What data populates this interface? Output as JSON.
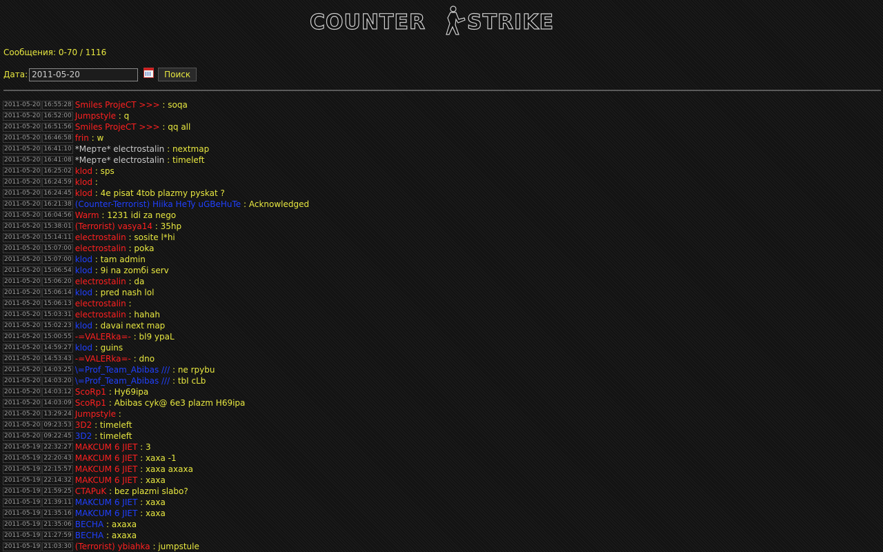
{
  "logo": {
    "text_left": "COUNTER",
    "text_right": "STRIKE"
  },
  "counter_label": "Сообщения: 0-70 / 1116",
  "search": {
    "label": "Дата:",
    "value": "2011-05-20",
    "calendar_icon": "calendar-icon",
    "button_label": "Поиск"
  },
  "colors": {
    "red": "#ff2020",
    "blue": "#2040ff",
    "gray": "#c8c8c8",
    "text": "#e8e840"
  },
  "messages": [
    {
      "date": "2011-05-20",
      "time": "16:55:28",
      "nick": "Smiles ProjeCT >>>",
      "color": "red",
      "text": "soqa"
    },
    {
      "date": "2011-05-20",
      "time": "16:52:00",
      "nick": "Jumpstyle",
      "color": "red",
      "text": "q"
    },
    {
      "date": "2011-05-20",
      "time": "16:51:56",
      "nick": "Smiles ProjeCT >>>",
      "color": "red",
      "text": "qq all"
    },
    {
      "date": "2011-05-20",
      "time": "16:46:58",
      "nick": "frin",
      "color": "red",
      "text": "w"
    },
    {
      "date": "2011-05-20",
      "time": "16:41:10",
      "nick": "*Мерте* electrostalin",
      "color": "gray",
      "text": "nextmap"
    },
    {
      "date": "2011-05-20",
      "time": "16:41:08",
      "nick": "*Мерте* electrostalin",
      "color": "gray",
      "text": "timeleft"
    },
    {
      "date": "2011-05-20",
      "time": "16:25:02",
      "nick": "klod",
      "color": "red",
      "text": "sps"
    },
    {
      "date": "2011-05-20",
      "time": "16:24:59",
      "nick": "klod",
      "color": "red",
      "text": ""
    },
    {
      "date": "2011-05-20",
      "time": "16:24:45",
      "nick": "klod",
      "color": "red",
      "text": "4e pisat 4tob plazmy pyskat ?"
    },
    {
      "date": "2011-05-20",
      "time": "16:21:38",
      "nick": "(Counter-Terrorist) Hiika HeTy uGBeHuTe",
      "color": "blue",
      "text": "Acknowledged"
    },
    {
      "date": "2011-05-20",
      "time": "16:04:56",
      "nick": "Warm",
      "color": "red",
      "text": "1231 idi za nego"
    },
    {
      "date": "2011-05-20",
      "time": "15:38:01",
      "nick": "(Terrorist) vasya14",
      "color": "red",
      "text": "35hp"
    },
    {
      "date": "2011-05-20",
      "time": "15:14:11",
      "nick": "electrostalin",
      "color": "red",
      "text": "sosite l*hi"
    },
    {
      "date": "2011-05-20",
      "time": "15:07:00",
      "nick": "electrostalin",
      "color": "red",
      "text": "poka"
    },
    {
      "date": "2011-05-20",
      "time": "15:07:00",
      "nick": "klod",
      "color": "blue",
      "text": "tam admin"
    },
    {
      "date": "2011-05-20",
      "time": "15:06:54",
      "nick": "klod",
      "color": "blue",
      "text": "9i na zomбi serv"
    },
    {
      "date": "2011-05-20",
      "time": "15:06:20",
      "nick": "electrostalin",
      "color": "red",
      "text": "da"
    },
    {
      "date": "2011-05-20",
      "time": "15:06:14",
      "nick": "klod",
      "color": "blue",
      "text": "pred nash lol"
    },
    {
      "date": "2011-05-20",
      "time": "15:06:13",
      "nick": "electrostalin",
      "color": "red",
      "text": ""
    },
    {
      "date": "2011-05-20",
      "time": "15:03:31",
      "nick": "electrostalin",
      "color": "red",
      "text": "hahah"
    },
    {
      "date": "2011-05-20",
      "time": "15:02:23",
      "nick": "klod",
      "color": "blue",
      "text": "davai next map"
    },
    {
      "date": "2011-05-20",
      "time": "15:00:55",
      "nick": "-=VALERka=-",
      "color": "red",
      "text": "bl9 ypaL"
    },
    {
      "date": "2011-05-20",
      "time": "14:59:27",
      "nick": "klod",
      "color": "blue",
      "text": "guins"
    },
    {
      "date": "2011-05-20",
      "time": "14:53:43",
      "nick": "-=VALERka=-",
      "color": "red",
      "text": "dno"
    },
    {
      "date": "2011-05-20",
      "time": "14:03:25",
      "nick": "\\=Prof_Team_Abibas ///",
      "color": "blue",
      "text": "ne rpybu"
    },
    {
      "date": "2011-05-20",
      "time": "14:03:20",
      "nick": "\\=Prof_Team_Abibas ///",
      "color": "blue",
      "text": "tbI cLb"
    },
    {
      "date": "2011-05-20",
      "time": "14:03:12",
      "nick": "ScoRp1",
      "color": "red",
      "text": "Hy69ipa"
    },
    {
      "date": "2011-05-20",
      "time": "14:03:09",
      "nick": "ScoRp1",
      "color": "red",
      "text": "Abibas cyk@ 6e3 plazm H69ipa"
    },
    {
      "date": "2011-05-20",
      "time": "13:29:24",
      "nick": "Jumpstyle",
      "color": "red",
      "text": ""
    },
    {
      "date": "2011-05-20",
      "time": "09:23:53",
      "nick": "3D2",
      "color": "red",
      "text": "timeleft"
    },
    {
      "date": "2011-05-20",
      "time": "09:22:45",
      "nick": "3D2",
      "color": "blue",
      "text": "timeleft"
    },
    {
      "date": "2011-05-19",
      "time": "22:32:27",
      "nick": "MAKCUM 6 JIET",
      "color": "red",
      "text": "3"
    },
    {
      "date": "2011-05-19",
      "time": "22:20:43",
      "nick": "MAKCUM 6 JIET",
      "color": "red",
      "text": "xaxa -1"
    },
    {
      "date": "2011-05-19",
      "time": "22:15:57",
      "nick": "MAKCUM 6 JIET",
      "color": "red",
      "text": "xaxa axaxa"
    },
    {
      "date": "2011-05-19",
      "time": "22:14:32",
      "nick": "MAKCUM 6 JIET",
      "color": "red",
      "text": "xaxa"
    },
    {
      "date": "2011-05-19",
      "time": "21:59:25",
      "nick": "CTAPuK",
      "color": "red",
      "text": "bez plazmi slabo?"
    },
    {
      "date": "2011-05-19",
      "time": "21:39:11",
      "nick": "MAKCUM 6 JIET",
      "color": "blue",
      "text": "xaxa"
    },
    {
      "date": "2011-05-19",
      "time": "21:35:16",
      "nick": "MAKCUM 6 JIET",
      "color": "blue",
      "text": "xaxa"
    },
    {
      "date": "2011-05-19",
      "time": "21:35:06",
      "nick": "BECHA",
      "color": "blue",
      "text": "axaxa"
    },
    {
      "date": "2011-05-19",
      "time": "21:27:59",
      "nick": "BECHA",
      "color": "blue",
      "text": "axaxa"
    },
    {
      "date": "2011-05-19",
      "time": "21:03:30",
      "nick": "(Terrorist) ybiahka",
      "color": "red",
      "text": "jumpstule"
    }
  ]
}
